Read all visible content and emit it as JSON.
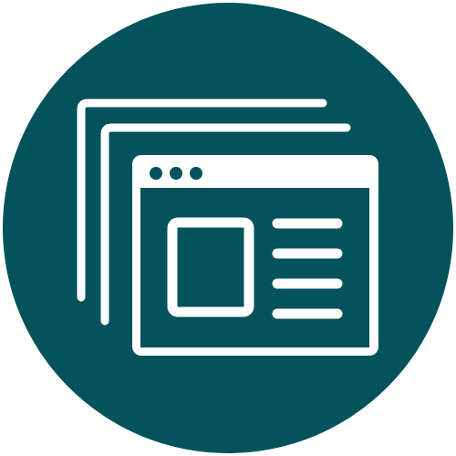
{
  "icon": {
    "name": "browser-windows-icon",
    "colors": {
      "circle": "#03525C",
      "stroke": "#FFFFFF",
      "page_background": "#FFFFFF"
    },
    "window_control_dots": 3,
    "content_text_lines": 4
  }
}
